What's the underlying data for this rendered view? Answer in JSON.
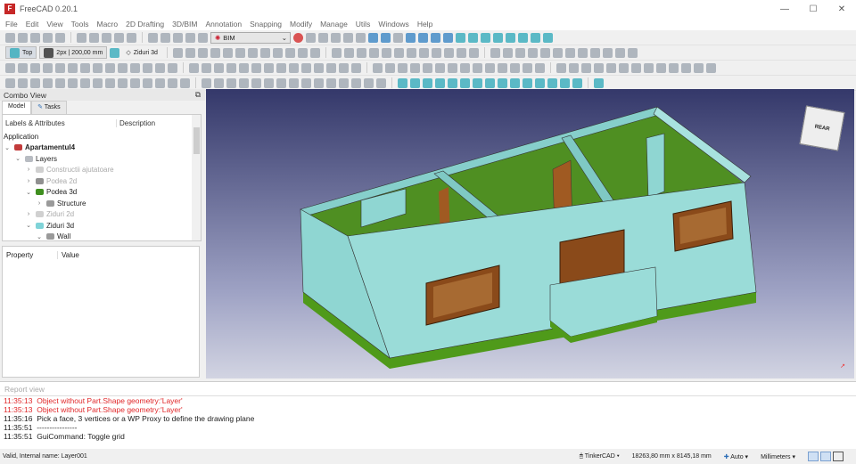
{
  "window": {
    "title": "FreeCAD 0.20.1",
    "logo": "Fc",
    "controls": [
      "—",
      "☐",
      "✕"
    ]
  },
  "menu": [
    "File",
    "Edit",
    "View",
    "Tools",
    "Macro",
    "2D Drafting",
    "3D/BIM",
    "Annotation",
    "Snapping",
    "Modify",
    "Manage",
    "Utils",
    "Windows",
    "Help"
  ],
  "toolbar": {
    "workbench": "BIM",
    "view_button": "Top",
    "line_style": "2px | 200,00 mm",
    "working_plane": "Ziduri 3d"
  },
  "combo_view": {
    "title": "Combo View",
    "tabs": [
      "Model",
      "Tasks"
    ],
    "columns": [
      "Labels & Attributes",
      "Description"
    ],
    "tree": [
      {
        "label": "Application",
        "level": 0,
        "chev": "",
        "dim": false,
        "bold": false
      },
      {
        "label": "Apartamentul4",
        "level": 0,
        "chev": "⌄",
        "dim": false,
        "bold": true,
        "icon": "#c23b3b"
      },
      {
        "label": "Layers",
        "level": 1,
        "chev": "⌄",
        "dim": false,
        "bold": false,
        "icon": "#b8bcc2"
      },
      {
        "label": "Constructii ajutatoare",
        "level": 2,
        "chev": "›",
        "dim": true,
        "bold": false,
        "icon": "#d0d0d0"
      },
      {
        "label": "Podea 2d",
        "level": 2,
        "chev": "›",
        "dim": true,
        "bold": false,
        "icon": "#909090"
      },
      {
        "label": "Podea 3d",
        "level": 2,
        "chev": "⌄",
        "dim": false,
        "bold": false,
        "icon": "#3f8f1f"
      },
      {
        "label": "Structure",
        "level": 3,
        "chev": "›",
        "dim": false,
        "bold": false,
        "icon": "#9a9a9a"
      },
      {
        "label": "Ziduri 2d",
        "level": 2,
        "chev": "›",
        "dim": true,
        "bold": false,
        "icon": "#d0d0d0"
      },
      {
        "label": "Ziduri 3d",
        "level": 2,
        "chev": "⌄",
        "dim": false,
        "bold": false,
        "icon": "#7fd3d8"
      },
      {
        "label": "Wall",
        "level": 3,
        "chev": "⌄",
        "dim": false,
        "bold": false,
        "icon": "#9a9a9a"
      }
    ],
    "property_columns": [
      "Property",
      "Value"
    ]
  },
  "report": {
    "title": "Report view",
    "lines": [
      {
        "time": "11:35:13",
        "text": "Object without Part.Shape geometry:'Layer'",
        "error": true
      },
      {
        "time": "11:35:13",
        "text": "Object without Part.Shape geometry:'Layer'",
        "error": true
      },
      {
        "time": "11:35:16",
        "text": "Pick a face, 3 vertices or a WP Proxy to define the drawing plane",
        "error": false
      },
      {
        "time": "11:35:51",
        "text": "----------------",
        "error": false
      },
      {
        "time": "11:35:51",
        "text": "GuiCommand: Toggle grid",
        "error": false
      }
    ]
  },
  "status": {
    "message": "Valid, Internal name: Layer001",
    "navigation": "TinkerCAD",
    "dimensions": "18263,80 mm x 8145,18 mm",
    "mode": "Auto",
    "units": "Millimeters"
  },
  "navcube": {
    "face": "REAR"
  },
  "colors": {
    "wall": "#8fd6d2",
    "floor": "#4f9a1a",
    "wood": "#8a4a1a",
    "viewport_top": "#34386a"
  }
}
